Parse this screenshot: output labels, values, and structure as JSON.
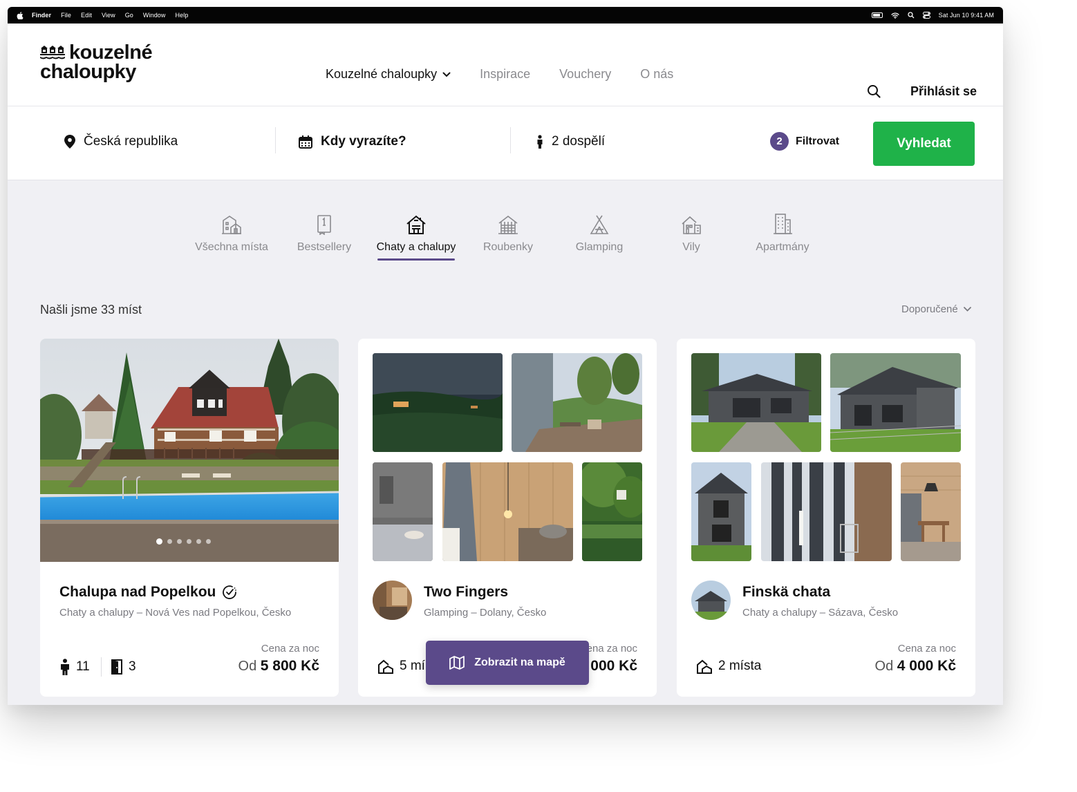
{
  "menubar": {
    "app": "Finder",
    "items": [
      "File",
      "Edit",
      "View",
      "Go",
      "Window",
      "Help"
    ],
    "datetime": "Sat Jun 10  9:41 AM"
  },
  "header": {
    "logo_line1": "kouzelné",
    "logo_line2": "chaloupky",
    "nav": [
      {
        "label": "Kouzelné chaloupky"
      },
      {
        "label": "Inspirace"
      },
      {
        "label": "Vouchery"
      },
      {
        "label": "O nás"
      }
    ],
    "login": "Přihlásit se"
  },
  "search": {
    "location": "Česká republika",
    "date": "Kdy vyrazíte?",
    "guests": "2 dospělí",
    "filter_count": "2",
    "filter_label": "Filtrovat",
    "submit": "Vyhledat"
  },
  "categories": [
    {
      "label": "Všechna místa",
      "icon": "all-places-icon"
    },
    {
      "label": "Bestsellery",
      "icon": "bestseller-icon"
    },
    {
      "label": "Chaty a chalupy",
      "icon": "cottage-icon",
      "active": true
    },
    {
      "label": "Roubenky",
      "icon": "log-cabin-icon"
    },
    {
      "label": "Glamping",
      "icon": "tent-icon"
    },
    {
      "label": "Vily",
      "icon": "villa-icon"
    },
    {
      "label": "Apartmány",
      "icon": "apartment-icon"
    }
  ],
  "results": {
    "count_text": "Našli jsme 33 míst",
    "sort_label": "Doporučené"
  },
  "cards": [
    {
      "title": "Chalupa nad Popelkou",
      "subtitle": "Chaty a chalupy – Nová Ves nad Popelkou, Česko",
      "guests": "11",
      "rooms": "3",
      "price_label": "Cena za noc",
      "price_from": "Od",
      "price": "5 800 Kč"
    },
    {
      "title": "Two Fingers",
      "subtitle": "Glamping – Dolany, Česko",
      "places": "5 mí",
      "price_label": "ena za noc",
      "price": "000 Kč"
    },
    {
      "title": "Finskä chata",
      "subtitle": "Chaty a chalupy – Sázava, Česko",
      "places": "2 místa",
      "price_label": "Cena za noc",
      "price_from": "Od",
      "price": "4 000 Kč"
    }
  ],
  "map_button": "Zobrazit na mapě",
  "colors": {
    "accent": "#5b4a8a",
    "primary_button": "#1fb249",
    "background": "#f0f0f4"
  }
}
